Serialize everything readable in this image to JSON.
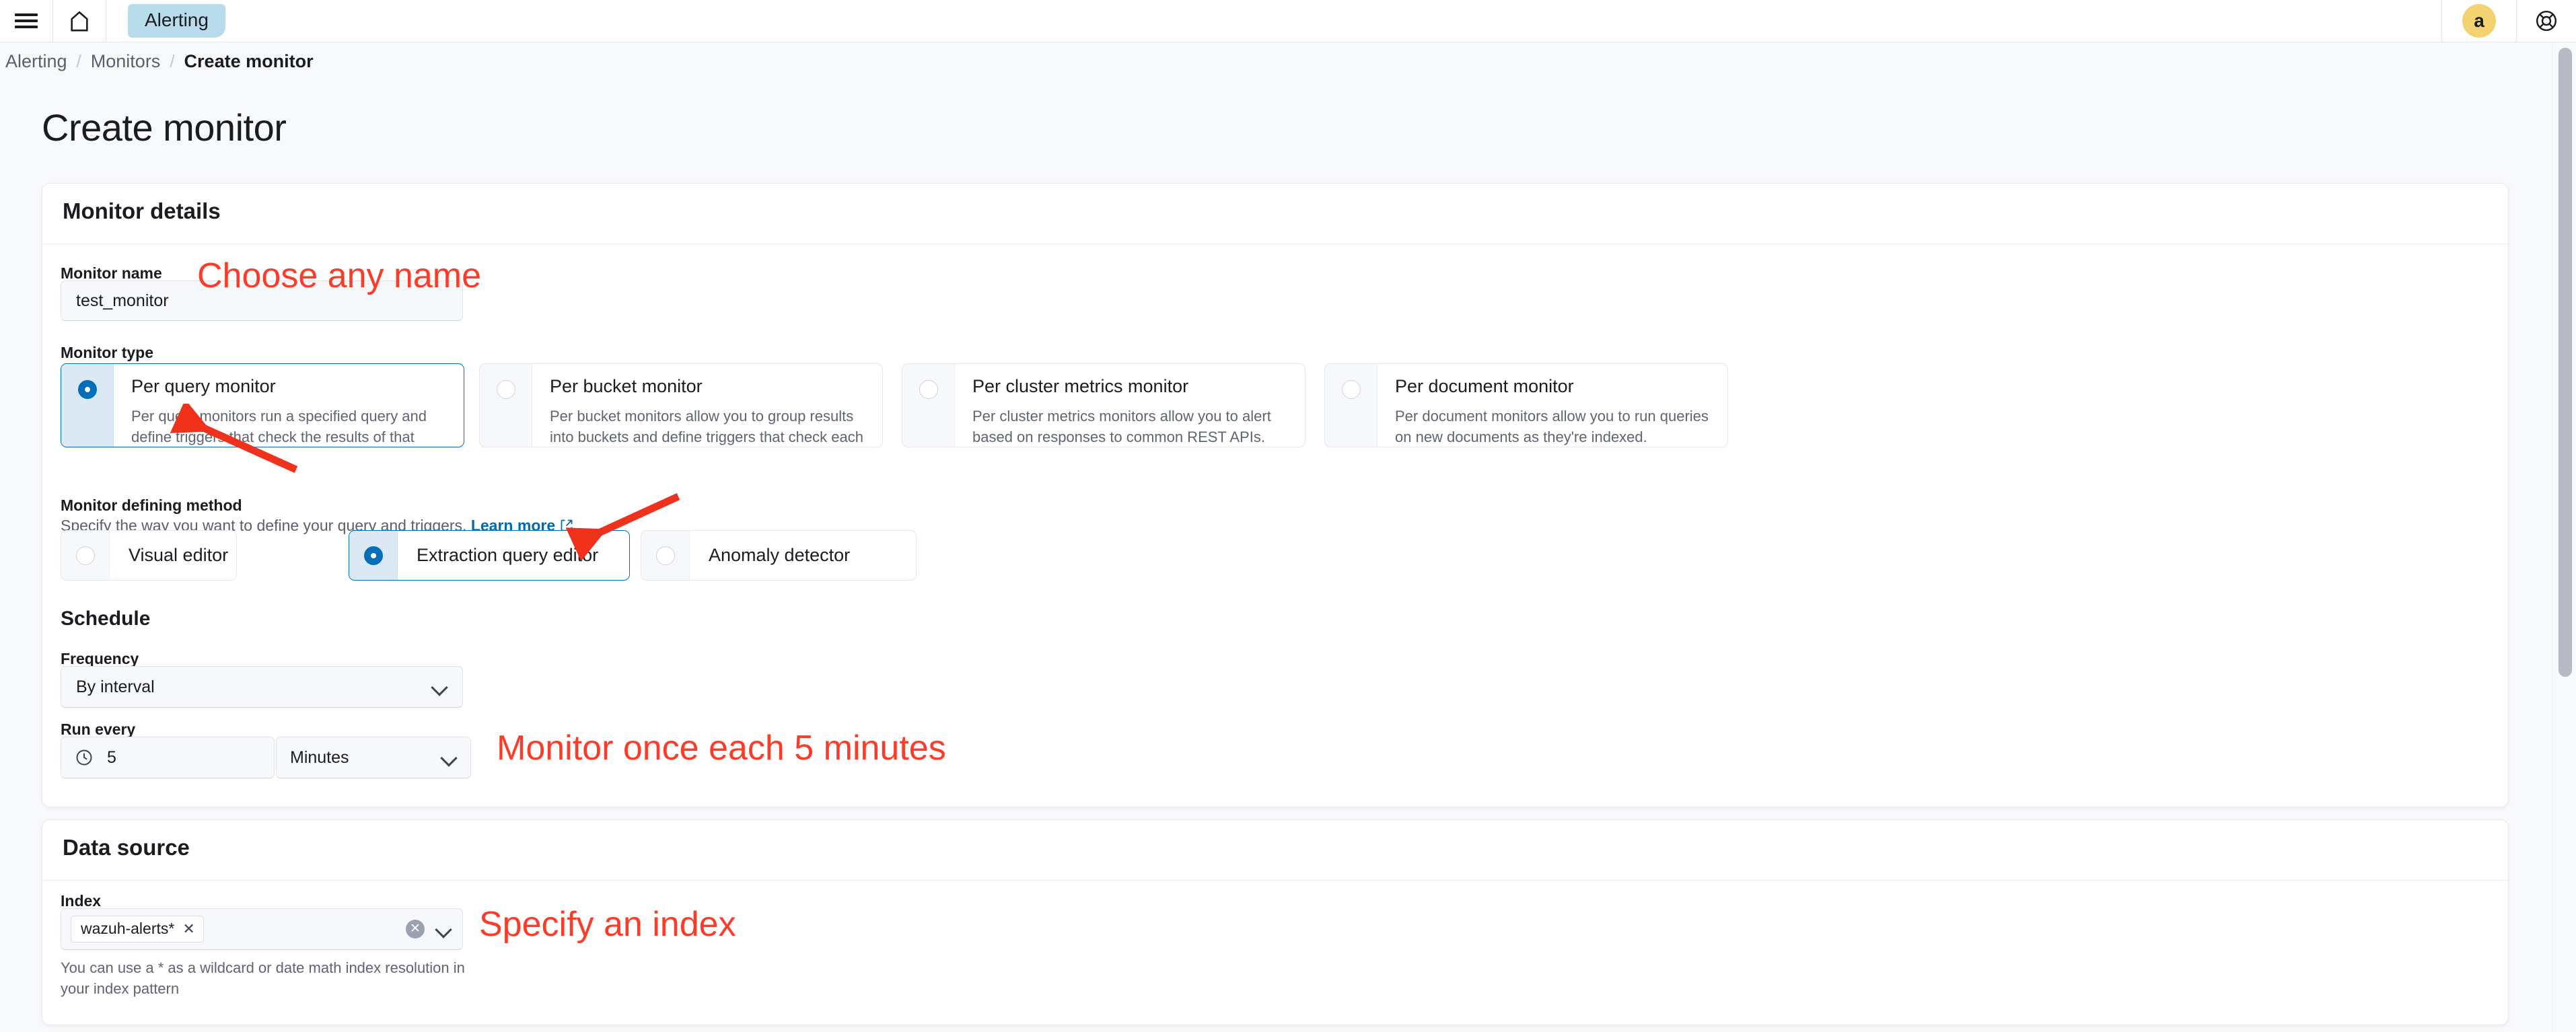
{
  "topnav": {
    "menu_icon": "hamburger-menu-icon",
    "home_icon": "home-icon",
    "app_chip": "Alerting",
    "avatar_initial": "a",
    "help_icon": "help-lifebuoy-icon"
  },
  "breadcrumb": {
    "items": [
      "Alerting",
      "Monitors",
      "Create monitor"
    ],
    "separator": "/"
  },
  "page": {
    "title": "Create monitor"
  },
  "monitor_details": {
    "panel_title": "Monitor details",
    "monitor_name": {
      "label": "Monitor name",
      "value": "test_monitor"
    },
    "monitor_type": {
      "label": "Monitor type",
      "options": [
        {
          "title": "Per query monitor",
          "description": "Per query monitors run a specified query and define triggers that check the results of that query.",
          "selected": true
        },
        {
          "title": "Per bucket monitor",
          "description": "Per bucket monitors allow you to group results into buckets and define triggers that check each bucket.",
          "selected": false
        },
        {
          "title": "Per cluster metrics monitor",
          "description": "Per cluster metrics monitors allow you to alert based on responses to common REST APIs.",
          "selected": false
        },
        {
          "title": "Per document monitor",
          "description": "Per document monitors allow you to run queries on new documents as they're indexed.",
          "selected": false
        }
      ]
    },
    "defining_method": {
      "label": "Monitor defining method",
      "sublabel": "Specify the way you want to define your query and triggers.",
      "learn_more": "Learn more",
      "external_link_icon": "external-link-icon",
      "options": [
        {
          "label": "Visual editor",
          "selected": false
        },
        {
          "label": "Extraction query editor",
          "selected": true
        },
        {
          "label": "Anomaly detector",
          "selected": false
        }
      ]
    },
    "schedule": {
      "heading": "Schedule",
      "frequency_label": "Frequency",
      "frequency_value": "By interval",
      "run_every_label": "Run every",
      "run_every_value": "5",
      "run_every_unit": "Minutes",
      "clock_icon": "clock-icon",
      "chevron_icon": "chevron-down-icon"
    }
  },
  "data_source": {
    "panel_title": "Data source",
    "index_label": "Index",
    "index_pills": [
      "wazuh-alerts*"
    ],
    "pill_remove_icon": "close-x-icon",
    "clear_icon": "clear-all-icon",
    "chevron_icon": "chevron-down-icon",
    "help_text": "You can use a * as a wildcard or date math index resolution in your index pattern"
  },
  "annotations": {
    "color": "#fc3b28",
    "notes": [
      {
        "text": "Choose any name"
      },
      {
        "text": "Monitor once each 5 minutes"
      },
      {
        "text": "Specify an index"
      }
    ],
    "arrows": [
      {
        "name": "arrow-to-per-query-monitor"
      },
      {
        "name": "arrow-to-extraction-query-editor"
      }
    ]
  },
  "colors": {
    "accent_blue": "#0270b8",
    "chip_blue": "#b9dcec",
    "avatar_yellow": "#f3d371",
    "annotation_red": "#fc3b28",
    "selected_strip": "#dce9f5"
  }
}
